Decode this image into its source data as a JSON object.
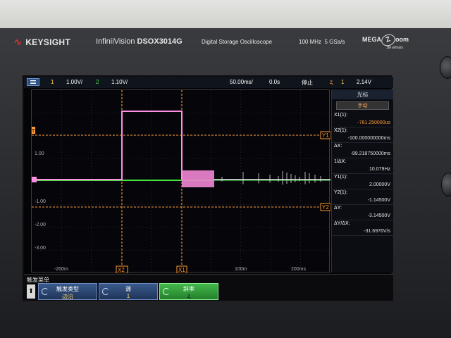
{
  "instrument": {
    "brand": "KEYSIGHT",
    "model_prefix": "InfiniiVision",
    "model": "DSOX3014G",
    "description": "Digital Storage Oscilloscope",
    "bandwidth": "100 MHz",
    "sample_rate": "5 GSa/s",
    "megazoom_label": "MEGA",
    "megazoom_letter": "Z",
    "megazoom_word": "oom",
    "megazoom_sub": "1M wfms/s"
  },
  "topbar": {
    "ch1_num": "1",
    "ch1_scale": "1.00V/",
    "ch2_num": "2",
    "ch2_scale": "1.10V/",
    "timebase": "50.00ms/",
    "delay": "0.0s",
    "run_state": "停止",
    "trig_icon": "ʐ",
    "trig_ch": "1",
    "trig_level": "2.14V"
  },
  "colors": {
    "ch1": "#ff8fe0",
    "ch2": "#42e33c",
    "cursor": "#ff9c3a",
    "trigger": "#ff9c3a",
    "grid": "#3a3a42"
  },
  "graticule": {
    "y_labels": [
      "1.00",
      "-1.00",
      "-2.00",
      "-3.00"
    ],
    "x_labels": [
      "-200m",
      "100m",
      "200ms"
    ],
    "cursor_tags": {
      "y1": "Y1",
      "y2": "Y2",
      "x1": "X1",
      "x2": "X2",
      "trig": "T"
    }
  },
  "cursors_panel": {
    "title": "光标",
    "mode_button": "手动",
    "rows": [
      {
        "label": "X1(1):",
        "value": "-781.250000us"
      },
      {
        "label": "X2(1):",
        "value": "-100.000000000ms"
      },
      {
        "label": "ΔX:",
        "value": "-99.218750000ms"
      },
      {
        "label": "1/ΔX:",
        "value": "10.079Hz"
      },
      {
        "label": "Y1(1):",
        "value": "2.00000V"
      },
      {
        "label": "Y2(1):",
        "value": "-1.14500V"
      },
      {
        "label": "ΔY:",
        "value": "-3.14500V"
      },
      {
        "label": "ΔY/ΔX:",
        "value": "-31.6976V/s"
      }
    ]
  },
  "softkeys": {
    "menu_title": "触发菜单",
    "up_arrow": "⬆",
    "k1_label": "触发类型",
    "k1_value": "边沿",
    "k2_label": "源",
    "k2_value": "1",
    "k3_label": "斜率",
    "k3_value": "ʐ"
  }
}
